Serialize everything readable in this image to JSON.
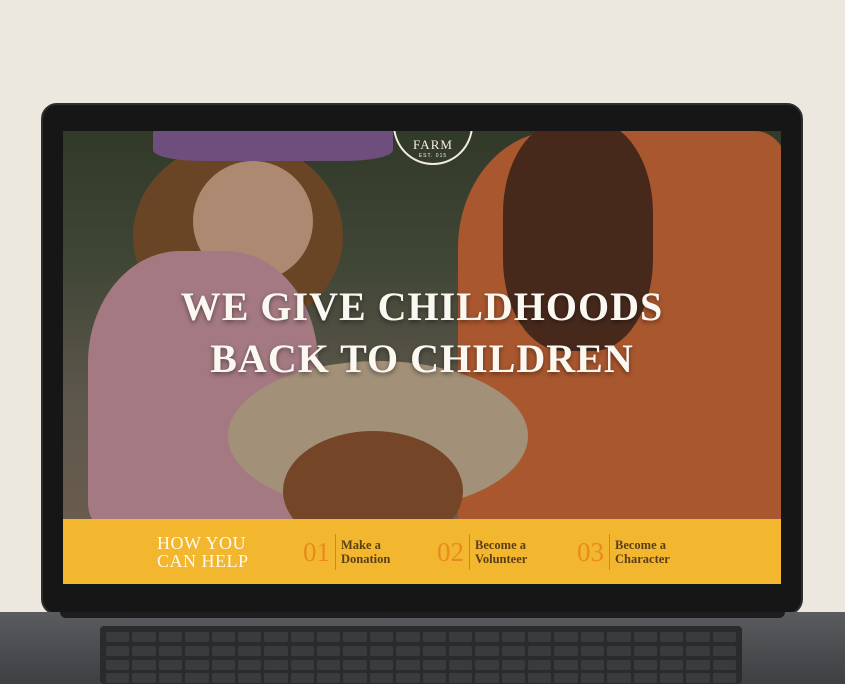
{
  "site": {
    "logo_text": "FARM",
    "logo_sub": "EST. 015"
  },
  "hero": {
    "headline_line1": "WE GIVE CHILDHOODS",
    "headline_line2": "BACK TO CHILDREN"
  },
  "help": {
    "title_line1": "HOW YOU",
    "title_line2": "CAN HELP",
    "options": [
      {
        "number": "01",
        "line1": "Make a",
        "line2": "Donation"
      },
      {
        "number": "02",
        "line1": "Become a",
        "line2": "Volunteer"
      },
      {
        "number": "03",
        "line1": "Become a",
        "line2": "Character"
      }
    ]
  },
  "colors": {
    "help_bar": "#f2b72f",
    "number_accent": "#e98a1e",
    "headline_text": "#fbf8f2"
  }
}
